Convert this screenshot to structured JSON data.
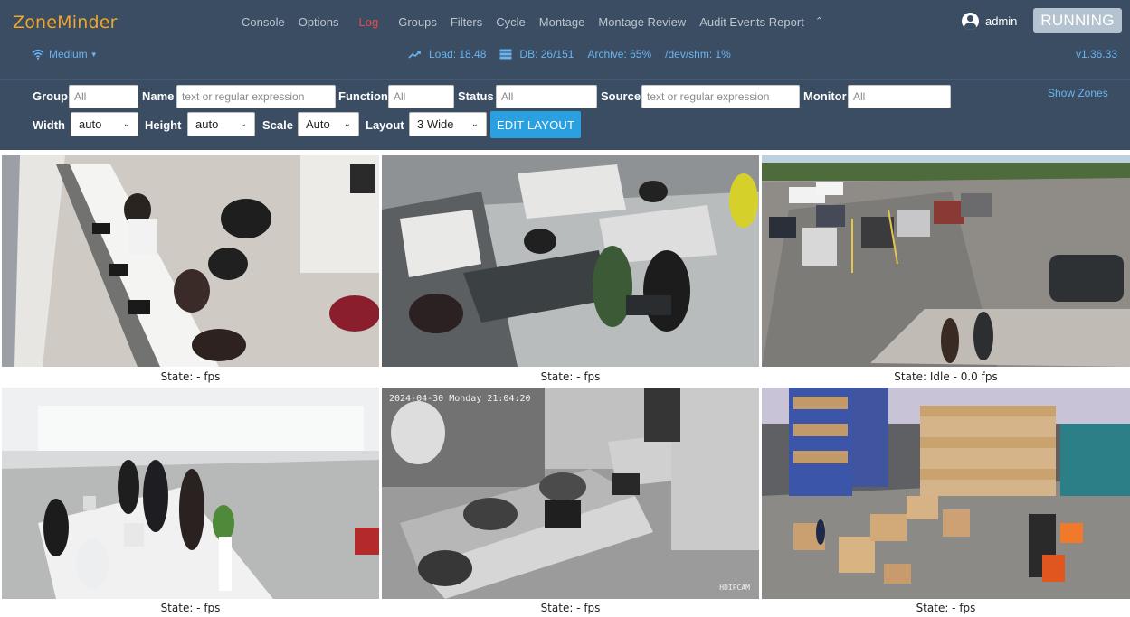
{
  "app": {
    "brand": "ZoneMinder",
    "version": "v1.36.33"
  },
  "nav": {
    "items": [
      "Console",
      "Options",
      "Log",
      "Groups",
      "Filters",
      "Cycle",
      "Montage",
      "Montage Review",
      "Audit Events Report"
    ],
    "active": "Log",
    "more_icon": "chevron-up-icon"
  },
  "user": {
    "name": "admin",
    "icon": "user-circle-icon"
  },
  "run_state": "RUNNING",
  "bandwidth": {
    "label": "Medium",
    "icon": "wifi-icon"
  },
  "stats": {
    "load": "Load: 18.48",
    "db": "DB: 26/151",
    "archive": "Archive: 65%",
    "shm": "/dev/shm: 1%"
  },
  "filters": {
    "group_label": "Group",
    "group_placeholder": "All",
    "name_label": "Name",
    "name_placeholder": "text or regular expression",
    "function_label": "Function",
    "function_placeholder": "All",
    "status_label": "Status",
    "status_placeholder": "All",
    "source_label": "Source",
    "source_placeholder": "text or regular expression",
    "monitor_label": "Monitor",
    "monitor_placeholder": "All",
    "show_zones": "Show Zones"
  },
  "layout_controls": {
    "width_label": "Width",
    "width_value": "auto",
    "height_label": "Height",
    "height_value": "auto",
    "scale_label": "Scale",
    "scale_value": "Auto",
    "layout_label": "Layout",
    "layout_value": "3 Wide",
    "edit_button": "EDIT LAYOUT"
  },
  "monitors": [
    {
      "scene": "office-desks",
      "state": "State:  -  fps"
    },
    {
      "scene": "open-office-meeting",
      "state": "State:  -  fps"
    },
    {
      "scene": "parking-lot",
      "state": "State: Idle - 0.0 fps"
    },
    {
      "scene": "reception-lobby",
      "state": "State:  -  fps"
    },
    {
      "scene": "night-vision-office",
      "state": "State:  -  fps",
      "overlay_timestamp": "2024-04-30  Monday  21:04:20",
      "overlay_brand": "HDIPCAM"
    },
    {
      "scene": "warehouse",
      "state": "State:  -  fps"
    }
  ],
  "colors": {
    "bar_bg": "#3a4d63",
    "brand": "#f0a52b",
    "active_nav": "#e8474b",
    "link": "#6cb4ee",
    "button": "#2aa0e0",
    "running_badge": "#b5c3d1"
  }
}
